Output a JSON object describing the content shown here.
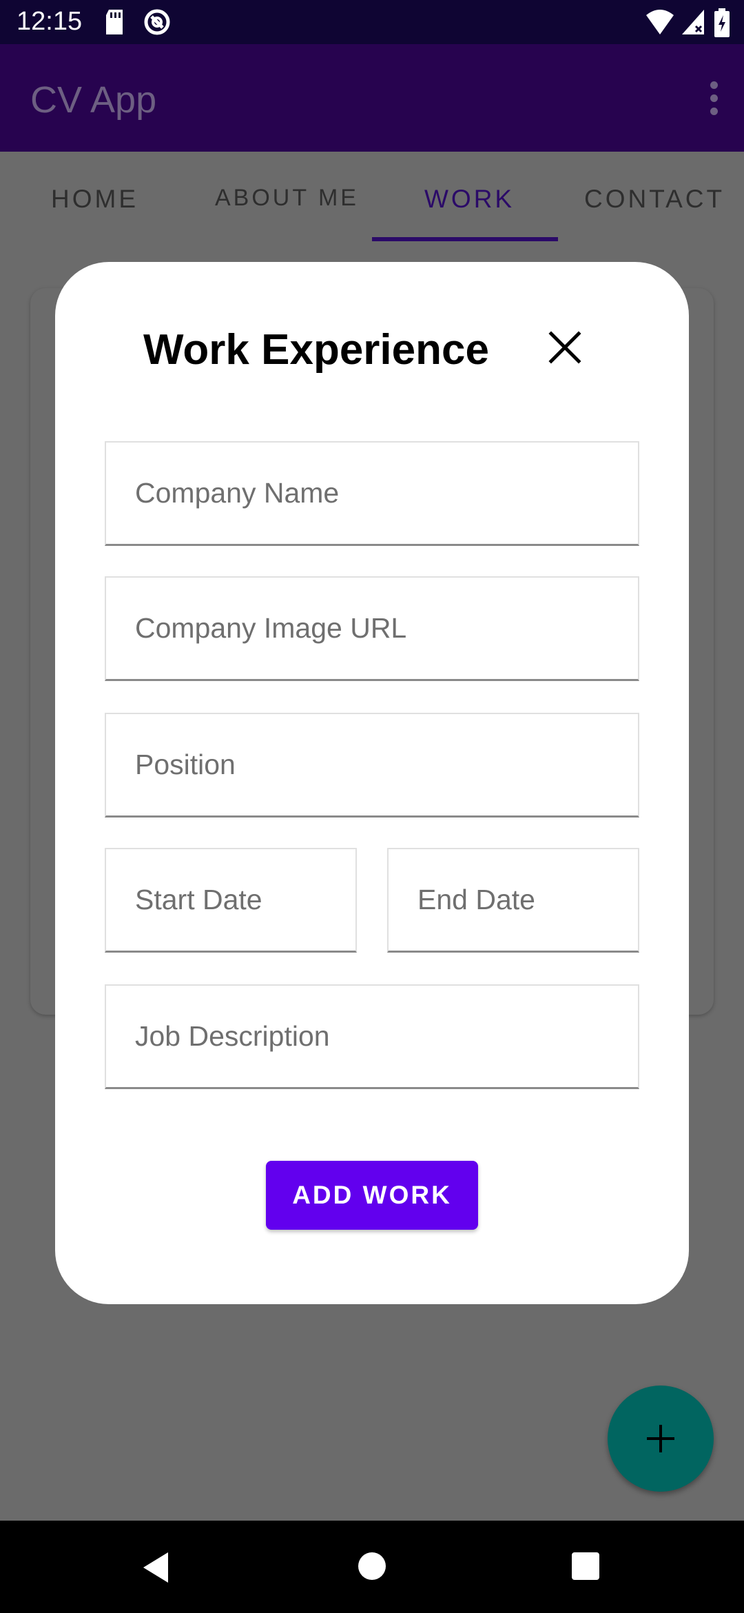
{
  "status_bar": {
    "time": "12:15"
  },
  "app_bar": {
    "title": "CV App"
  },
  "tabs": [
    {
      "label": "HOME"
    },
    {
      "label": "ABOUT ME"
    },
    {
      "label": "WORK"
    },
    {
      "label": "CONTACT"
    }
  ],
  "dialog": {
    "title": "Work Experience",
    "fields": {
      "company_name": "Company Name",
      "company_image_url": "Company Image URL",
      "position": "Position",
      "start_date": "Start Date",
      "end_date": "End Date",
      "job_description": "Job Description"
    },
    "submit_label": "ADD WORK"
  },
  "colors": {
    "primary": "#6200ee",
    "app_bar": "#27034f",
    "fab": "#016560"
  }
}
